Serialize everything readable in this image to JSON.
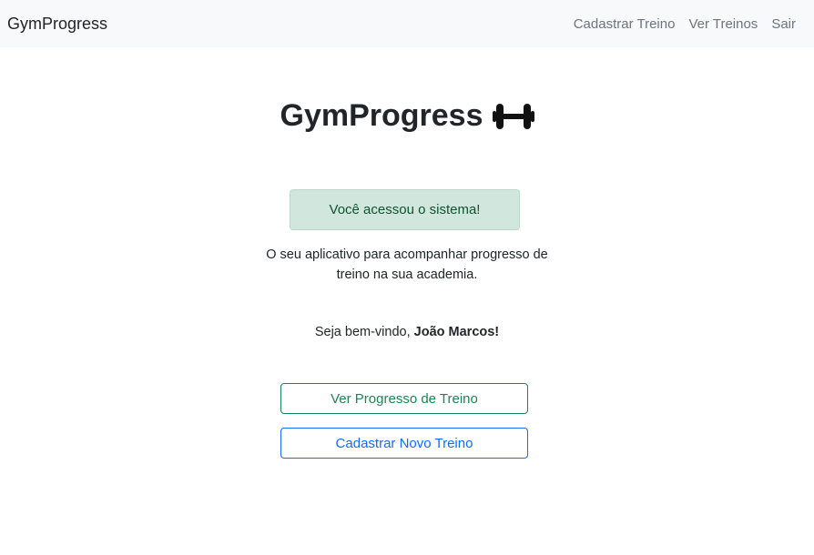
{
  "navbar": {
    "brand": "GymProgress",
    "links": [
      {
        "label": "Cadastrar Treino"
      },
      {
        "label": "Ver Treinos"
      },
      {
        "label": "Sair"
      }
    ]
  },
  "hero": {
    "title": "GymProgress",
    "icon": "dumbbell-icon"
  },
  "alert": {
    "message": "Você acessou o sistema!",
    "color": "#d1e7dd"
  },
  "description": "O seu aplicativo para acompanhar progresso de treino na sua academia.",
  "welcome": {
    "prefix": "Seja bem-vindo, ",
    "user_name": "João Marcos!"
  },
  "actions": {
    "progress_label": "Ver Progresso de Treino",
    "register_label": "Cadastrar Novo Treino"
  },
  "colors": {
    "success": "#198754",
    "primary": "#0d6efd"
  }
}
